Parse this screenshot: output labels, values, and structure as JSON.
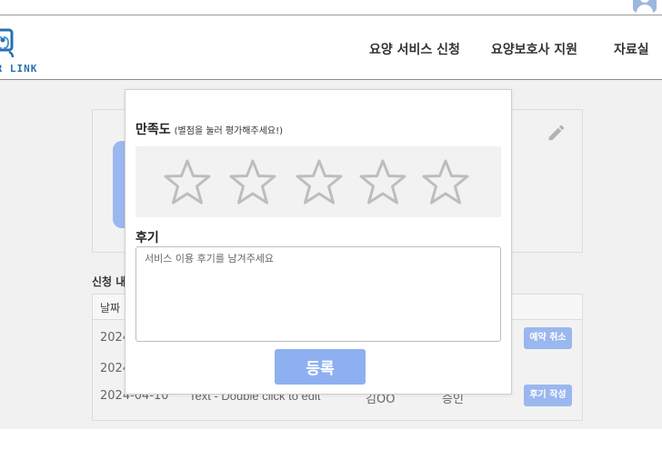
{
  "header": {
    "logo_text": "OR LINK",
    "nav": [
      {
        "label": "요양 서비스 신청"
      },
      {
        "label": "요양보호사 지원"
      },
      {
        "label": "자료실"
      }
    ]
  },
  "page": {
    "section_title": "신청 내",
    "table": {
      "headers": {
        "date": "날짜"
      },
      "rows": [
        {
          "date": "2024",
          "title": "",
          "name": "",
          "status": "",
          "action": "예약 취소"
        },
        {
          "date": "2024",
          "title": "",
          "name": "",
          "status": "",
          "action": ""
        },
        {
          "date": "2024-04-10",
          "title": "Text - Double click to edit",
          "name": "김OO",
          "status": "승인",
          "action": "후기 작성"
        }
      ]
    }
  },
  "modal": {
    "rating_label": "만족도",
    "rating_hint": "(별점을 눌러 평가해주세요!)",
    "rating_value": 0,
    "rating_max": 5,
    "review_label": "후기",
    "review_placeholder": "서비스 이용 후기를 남겨주세요",
    "review_value": "",
    "submit_label": "등록"
  },
  "colors": {
    "accent": "#8eb0f0",
    "accent_light": "#9bb7ef",
    "logo_blue": "#2a6fb1",
    "star_outline": "#bdbdbd",
    "page_bg": "#f1f1f1"
  },
  "icons": [
    "user-icon",
    "logo-icon",
    "pencil-icon",
    "star-icon"
  ]
}
